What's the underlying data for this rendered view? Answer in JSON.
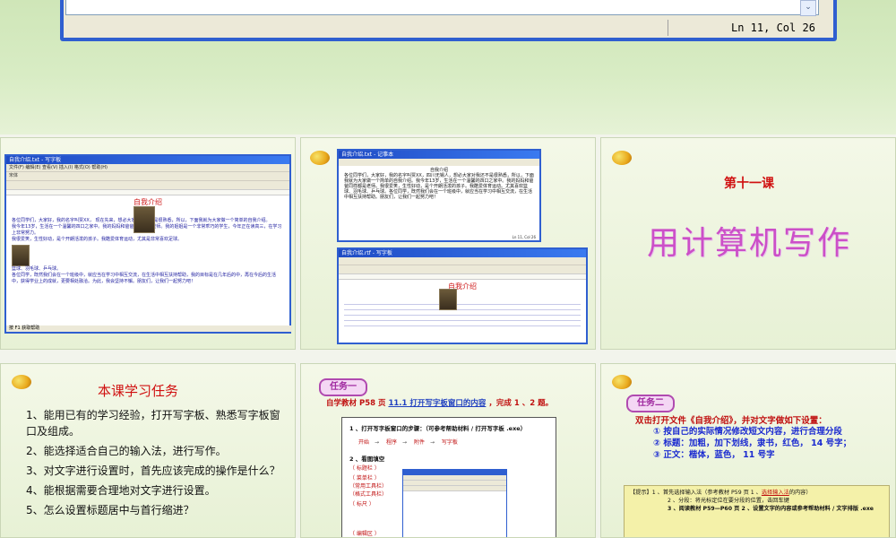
{
  "editor": {
    "scroll_glyph": "⌄",
    "status": "Ln 11, Col 26"
  },
  "slide1": {
    "window_title": "自我介绍.txt - 写字板",
    "menu": "文件(F)  编辑(E)  查看(V)  插入(I)  格式(O)  帮助(H)",
    "font_box": "宋体",
    "heading": "自我介绍",
    "para1": "各位同学们，大家好，我的名字叫贾XX，                        现在先来，想必大家对我还不是很熟悉，所以，下面我就为大家做一个简单的自我介绍。",
    "para2": "我今年13岁，生活在一个温馨的四口之家中。我的妈妈和爸爸同样都是老师。我的姐姐是一个非常乖巧的学生，今年正在读高三，在学习上非常努力。",
    "para3": "我很爱笑，生性好动，是个开朗活泼的孩子。我酷爱体育运动，尤其是非常喜欢足球。",
    "para4": "篮球、羽毛球、乒乓球。",
    "para5": "各位同学，既然我们会在一个班级中，就应当在学习中相互交流，在生活中相互扶持帮助，我的目标是在几年后的中，再在今后的生活中，获得学业上的成就，更要相处融洽。为此，我会坚持不懈。朋友们，让我们一起努力吧！",
    "status": "按 F1 获取帮助"
  },
  "slide2": {
    "window_title": "自我介绍.txt - 记事本",
    "heading": "自我介绍",
    "text": "各位同学们，大家好，我的名字叫贾XX，四川无锡人，想必大家对我还不是很熟悉，所以，下面我就为大家做一个简单的自我介绍。我今年13岁，生活在一个温馨的四口之家中。我的妈妈和爸爸同样都是老师。我很爱笑，生性好动，是个开朗活泼的孩子。我酷爱体育运动。尤其喜欢篮球、羽毛球、乒乓球。各位同学，既然我们会在一个班级中，就应当在学习中相互交流，在生活中相互扶持帮助。朋友们，让我们一起努力吧！",
    "status": "Ln 11, Col 26",
    "window2_title": "自我介绍.rtf - 写字板",
    "heading2": "自我介绍"
  },
  "slide3": {
    "lesson": "第十一课",
    "title": "用计算机写作"
  },
  "slide4": {
    "title": "本课学习任务",
    "items": [
      "1、能用已有的学习经验，打开写字板、熟悉写字板窗口及组成。",
      "2、能选择适合自己的输入法，进行写作。",
      "3、对文字进行设置时，首先应该完成的操作是什么？",
      "4、能根据需要合理地对文字进行设置。",
      "5、怎么设置标题居中与首行缩进？"
    ]
  },
  "slide5": {
    "badge": "任务一",
    "instruction_pre": "自学教材 P58 页",
    "instruction_link": "11.1 打开写字板窗口的内容",
    "instruction_post": "，完成 1 、2 题。",
    "q1": "1 、打开写字板窗口的步骤：（可参考帮助材料 / 打开写字板 .exe）",
    "steps": [
      "开始",
      "程序",
      "附件",
      "写字板"
    ],
    "q2": "2 、看图填空",
    "labels": [
      "（  标题栏  ）",
      "（  菜单栏  ）",
      "（常用工具栏）",
      "（格式工具栏）",
      "（    标尺    ）",
      "（    编辑区    ）"
    ]
  },
  "slide6": {
    "badge": "任务二",
    "lead": "双击打开文件《自我介绍》，并对文字做如下设置：",
    "items": [
      "① 按自己的实际情况修改短文内容，进行合理分段",
      "② 标题：加粗，加下划线，隶书，红色，  14 号字；",
      "③ 正文：楷体，蓝色，  11 号字"
    ],
    "hint_pre": "【提示】1 、首先选择输入法（参考教材 P59 页 1 、",
    "hint_link": "选择输入法",
    "hint_tail": "的内容）",
    "hint2": "2 、分段：将光标定位在要分段的位置，击回车键",
    "hint3": "3 、阅读教材 P59—P60 页 2 、设置文字的内容或参考帮助材料 / 文字排版 .exe"
  },
  "colors": {
    "window_blue": "#2f5fd0",
    "title_red": "#d01010",
    "lesson_magenta": "#cc4fc8",
    "task_purple": "#a02aa0",
    "hint_yellow": "#f4f1a9"
  },
  "icons": [
    "deredu-logo"
  ]
}
